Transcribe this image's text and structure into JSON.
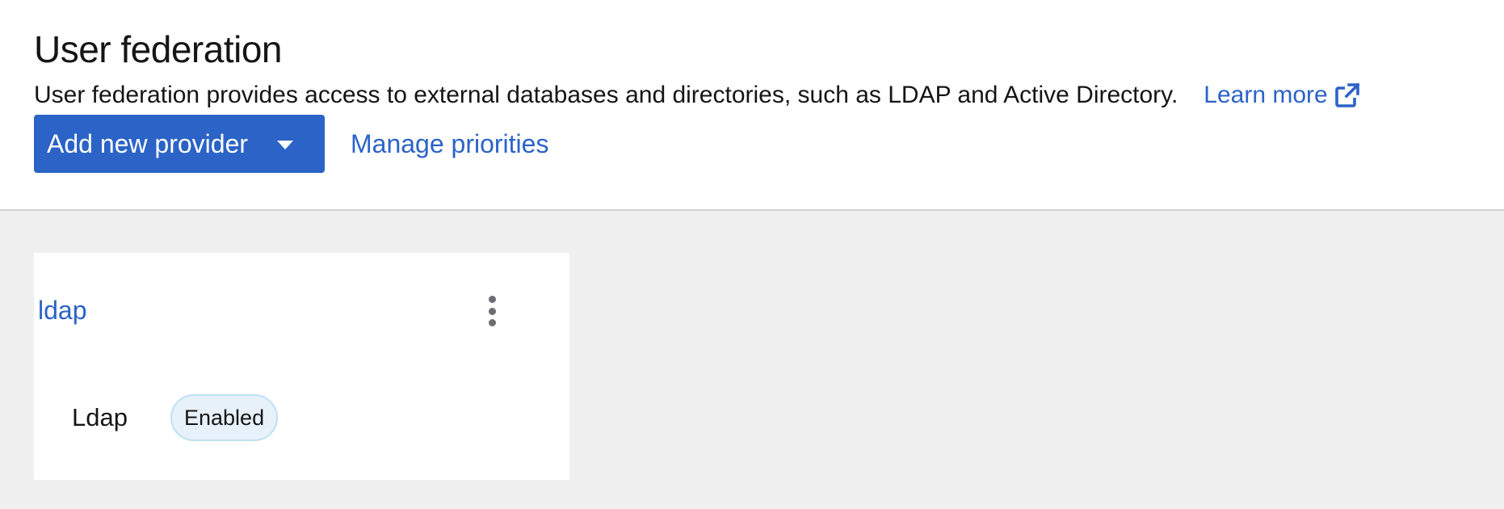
{
  "header": {
    "title": "User federation",
    "description": "User federation provides access to external databases and directories, such as LDAP and Active Directory.",
    "learn_more_label": "Learn more",
    "learn_more_icon": "external-link-icon"
  },
  "toolbar": {
    "add_provider_label": "Add new provider",
    "add_provider_icon": "caret-down-icon",
    "manage_priorities_label": "Manage priorities"
  },
  "colors": {
    "accent": "#2b63c7",
    "page_background": "#f0f0f0",
    "badge_background": "#e7f1fa",
    "badge_border": "#bee1f4"
  },
  "providers": [
    {
      "name": "ldap",
      "type": "Ldap",
      "status": "Enabled",
      "menu_icon": "kebab-menu-icon"
    }
  ]
}
